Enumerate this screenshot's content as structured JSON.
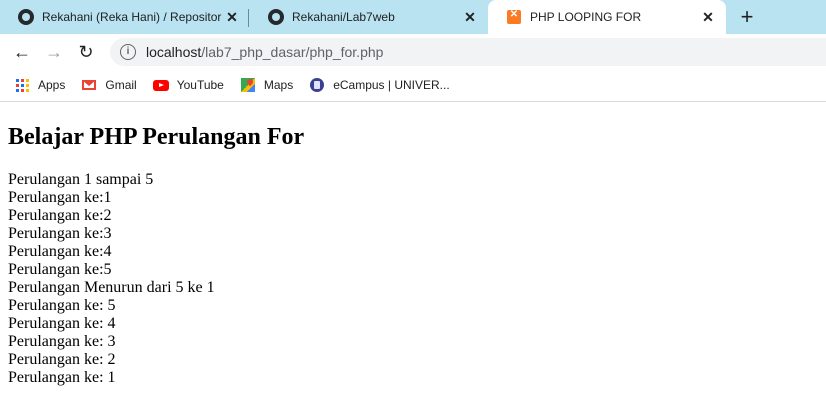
{
  "browser": {
    "tabs": [
      {
        "title": "Rekahani (Reka Hani) / Repositor",
        "icon": "github-icon",
        "active": false
      },
      {
        "title": "Rekahani/Lab7web",
        "icon": "github-icon",
        "active": false
      },
      {
        "title": "PHP LOOPING FOR",
        "icon": "xampp-icon",
        "active": true
      }
    ],
    "close_glyph": "✕",
    "new_tab_glyph": "+",
    "url_host": "localhost",
    "url_path": "/lab7_php_dasar/php_for.php",
    "bookmarks": [
      {
        "label": "Apps",
        "icon": "apps-grid-icon"
      },
      {
        "label": "Gmail",
        "icon": "gmail-icon"
      },
      {
        "label": "YouTube",
        "icon": "youtube-icon"
      },
      {
        "label": "Maps",
        "icon": "maps-icon"
      },
      {
        "label": "eCampus | UNIVER...",
        "icon": "ecampus-icon"
      }
    ]
  },
  "page": {
    "heading": "Belajar PHP Perulangan For",
    "lines": [
      "Perulangan 1 sampai 5",
      "Perulangan ke:1",
      "Perulangan ke:2",
      "Perulangan ke:3",
      "Perulangan ke:4",
      "Perulangan ke:5",
      "Perulangan Menurun dari 5 ke 1",
      "Perulangan ke: 5",
      "Perulangan ke: 4",
      "Perulangan ke: 3",
      "Perulangan ke: 2",
      "Perulangan ke: 1"
    ]
  },
  "colors": {
    "tabstrip": "#b9e3f0",
    "active_tab": "#ffffff",
    "omnibox": "#f1f3f4"
  }
}
